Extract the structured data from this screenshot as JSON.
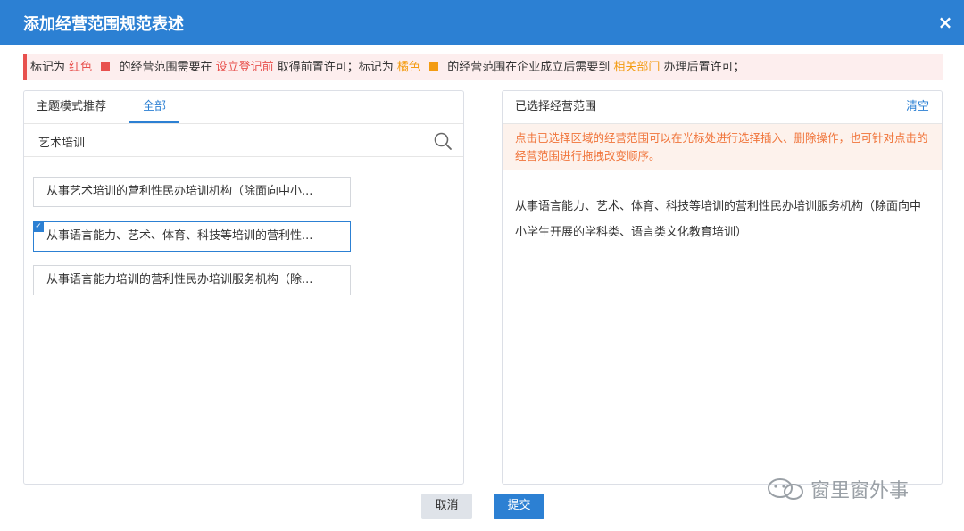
{
  "dialog": {
    "title": "添加经营范围规范表述",
    "close_icon": "×"
  },
  "notice": {
    "p1": "标记为",
    "red_label": "红色",
    "p2": "的经营范围需要在",
    "red_place": "设立登记前",
    "p3": "取得前置许可；标记为",
    "orange_label": "橘色",
    "p4": "的经营范围在企业成立后需要到",
    "orange_place": "相关部门",
    "p5": "办理后置许可；",
    "colors": {
      "red": "#e8514e",
      "orange": "#f39c12"
    }
  },
  "left": {
    "tabs": [
      {
        "label": "主题模式推荐",
        "active": false
      },
      {
        "label": "全部",
        "active": true
      }
    ],
    "search": {
      "value": "艺术培训",
      "placeholder": ""
    },
    "results": [
      {
        "label": "从事艺术培训的营利性民办培训机构（除面向中小...",
        "selected": false
      },
      {
        "label": "从事语言能力、艺术、体育、科技等培训的营利性...",
        "selected": true
      },
      {
        "label": "从事语言能力培训的营利性民办培训服务机构（除...",
        "selected": false
      }
    ]
  },
  "right": {
    "title": "已选择经营范围",
    "clear_label": "清空",
    "hint": "点击已选择区域的经营范围可以在光标处进行选择插入、删除操作，也可针对点击的经营范围进行拖拽改变顺序。",
    "selected_text": "从事语言能力、艺术、体育、科技等培训的营利性民办培训服务机构（除面向中小学生开展的学科类、语言类文化教育培训）"
  },
  "buttons": {
    "cancel": "取消",
    "submit": "提交"
  },
  "watermark": "窗里窗外事",
  "accent": "#2c80d3"
}
